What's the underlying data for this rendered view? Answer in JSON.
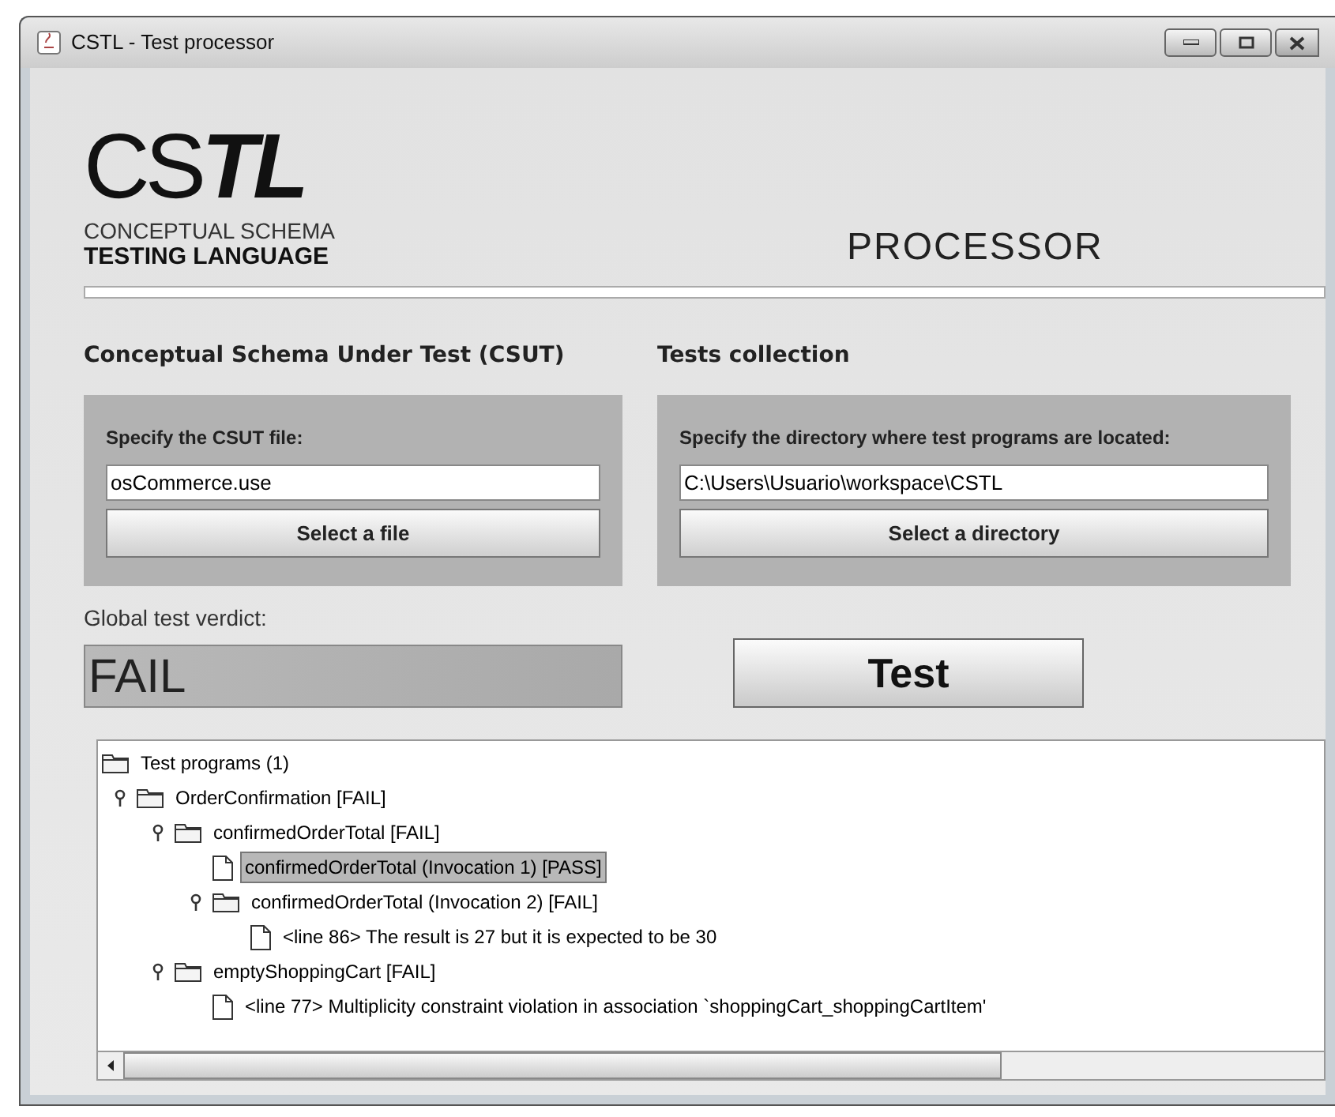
{
  "window": {
    "title": "CSTL - Test processor"
  },
  "header": {
    "logo": "CS**TL**",
    "tagline_1": "CONCEPTUAL SCHEMA",
    "tagline_2": "TESTING LANGUAGE",
    "title": "PROCESSOR"
  },
  "csut": {
    "heading": "Conceptual Schema Under Test (CSUT)",
    "label": "Specify the CSUT file:",
    "value": "osCommerce.use",
    "button": "Select a file"
  },
  "tests": {
    "heading": "Tests collection",
    "label": "Specify the directory where test programs are located:",
    "value": "C:\\Users\\Usuario\\workspace\\CSTL",
    "button": "Select a directory"
  },
  "verdict": {
    "label": "Global test verdict:",
    "value": "FAIL"
  },
  "test_button": "Test",
  "tree": [
    {
      "label": "Test programs (1)",
      "kind": "folder",
      "selected": false,
      "children": [
        {
          "label": "OrderConfirmation [FAIL]",
          "kind": "folder",
          "selected": false,
          "children": [
            {
              "label": "confirmedOrderTotal [FAIL]",
              "kind": "folder",
              "selected": false,
              "children": [
                {
                  "label": "confirmedOrderTotal (Invocation 1) [PASS]",
                  "kind": "file",
                  "selected": true
                },
                {
                  "label": "confirmedOrderTotal (Invocation 2) [FAIL]",
                  "kind": "folder",
                  "selected": false,
                  "children": [
                    {
                      "label": "<line 86> The result is 27 but it is expected to be 30",
                      "kind": "file",
                      "selected": false
                    }
                  ]
                }
              ]
            },
            {
              "label": "emptyShoppingCart [FAIL]",
              "kind": "folder",
              "selected": false,
              "children": [
                {
                  "label": "<line 77> Multiplicity constraint violation in association `shoppingCart_shoppingCartItem'",
                  "kind": "file",
                  "selected": false
                }
              ]
            }
          ]
        }
      ]
    }
  ]
}
